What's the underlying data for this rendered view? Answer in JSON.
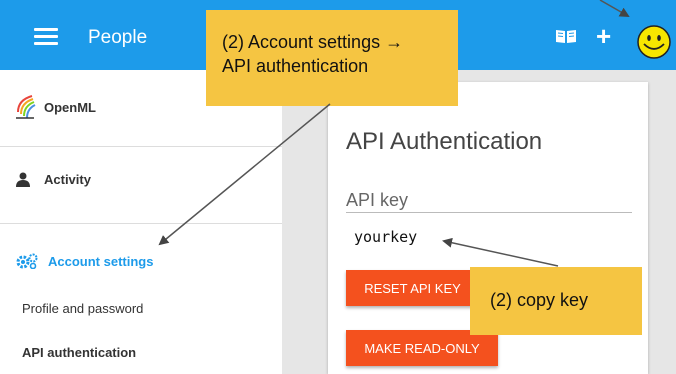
{
  "topbar": {
    "title": "People",
    "bg_color": "#1d9bea"
  },
  "sidebar": {
    "logo_text": "OpenML",
    "activity_label": "Activity",
    "account_settings_label": "Account settings",
    "sub_items": [
      {
        "label": "Profile and password",
        "active": false
      },
      {
        "label": "API authentication",
        "active": true
      }
    ],
    "accent_color": "#1d9bea"
  },
  "card": {
    "title": "API Authentication",
    "field_label": "API key",
    "key_value": "yourkey",
    "reset_button": "RESET API KEY",
    "readonly_button": "MAKE READ-ONLY",
    "button_color": "#f4511e"
  },
  "annotations": {
    "callout_account_line1": "(2) Account settings →",
    "callout_account_line2": "API authentication",
    "callout_copy": "(2) copy key",
    "callout_color": "#f5c542"
  },
  "icons": [
    "menu-icon",
    "book-icon",
    "plus-icon",
    "smiley-avatar-icon",
    "openml-logo-icon",
    "person-icon",
    "gears-icon"
  ]
}
